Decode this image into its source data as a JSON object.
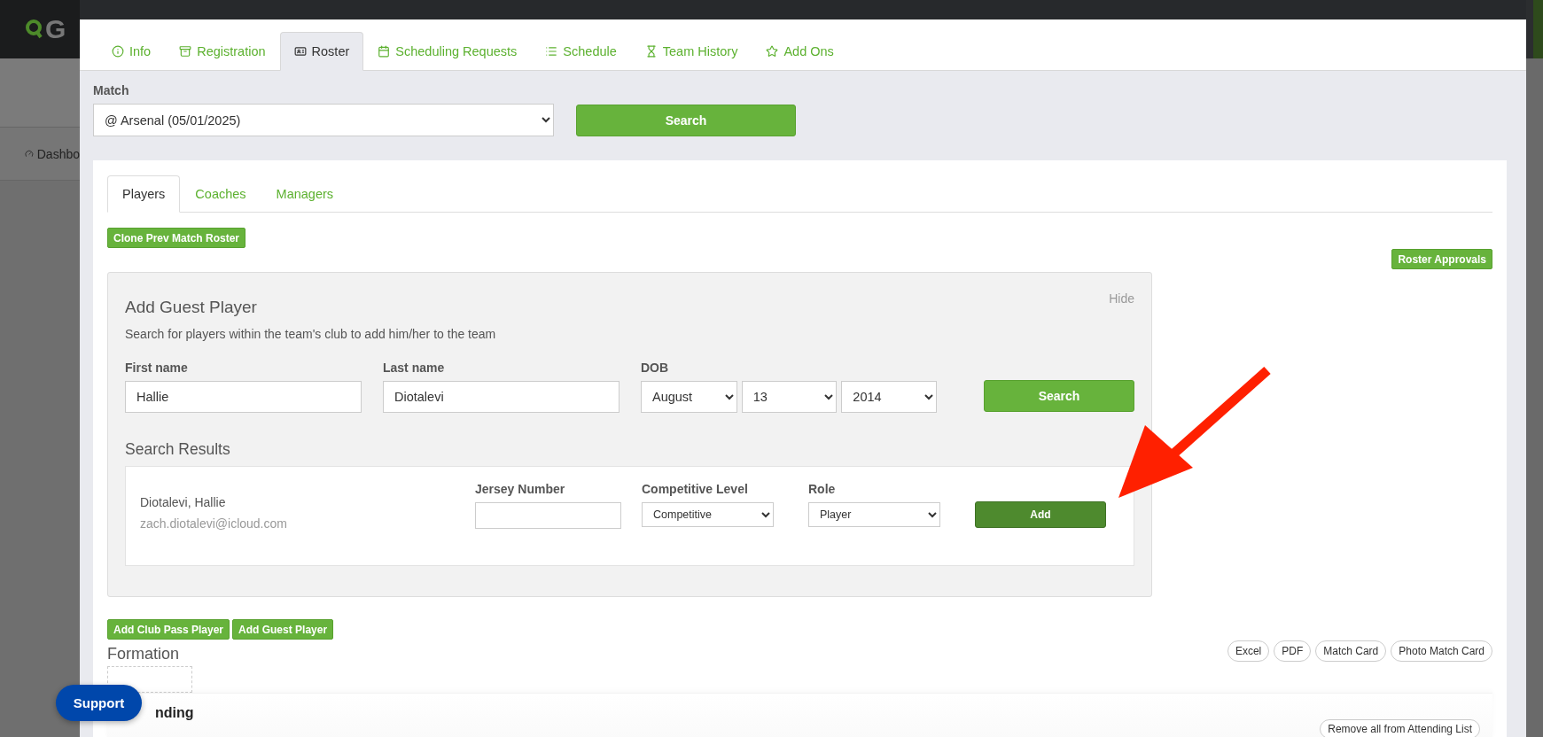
{
  "background": {
    "brand": "G",
    "nav_item": "Dashbo"
  },
  "tabs": [
    {
      "label": "Info",
      "selected": false
    },
    {
      "label": "Registration",
      "selected": false
    },
    {
      "label": "Roster",
      "selected": true
    },
    {
      "label": "Scheduling Requests",
      "selected": false
    },
    {
      "label": "Schedule",
      "selected": false
    },
    {
      "label": "Team History",
      "selected": false
    },
    {
      "label": "Add Ons",
      "selected": false
    }
  ],
  "match": {
    "label": "Match",
    "value": "@ Arsenal (05/01/2025)",
    "button": "Search"
  },
  "sub_tabs": [
    {
      "label": "Players",
      "selected": true
    },
    {
      "label": "Coaches",
      "selected": false
    },
    {
      "label": "Managers",
      "selected": false
    }
  ],
  "clone_button": "Clone Prev Match Roster",
  "roster_approvals_button": "Roster Approvals",
  "add_guest": {
    "title": "Add Guest Player",
    "hide": "Hide",
    "description": "Search for players within the team's club to add him/her to the team",
    "first_name": {
      "label": "First name",
      "value": "Hallie"
    },
    "last_name": {
      "label": "Last name",
      "value": "Diotalevi"
    },
    "dob": {
      "label": "DOB",
      "month": "August",
      "day": "13",
      "year": "2014"
    },
    "search_button": "Search",
    "results_title": "Search Results",
    "results": [
      {
        "name": "Diotalevi, Hallie",
        "email": "zach.diotalevi@icloud.com",
        "jersey_label": "Jersey Number",
        "level_label": "Competitive Level",
        "level_value": "Competitive",
        "role_label": "Role",
        "role_value": "Player",
        "add_button": "Add"
      }
    ]
  },
  "action_buttons": [
    "Add Club Pass Player",
    "Add Guest Player"
  ],
  "formation_title": "Formation",
  "export_buttons": [
    "Excel",
    "PDF",
    "Match Card",
    "Photo Match Card"
  ],
  "attending": {
    "title": "nding",
    "remove_button": "Remove all from Attending List"
  },
  "support_button": "Support"
}
